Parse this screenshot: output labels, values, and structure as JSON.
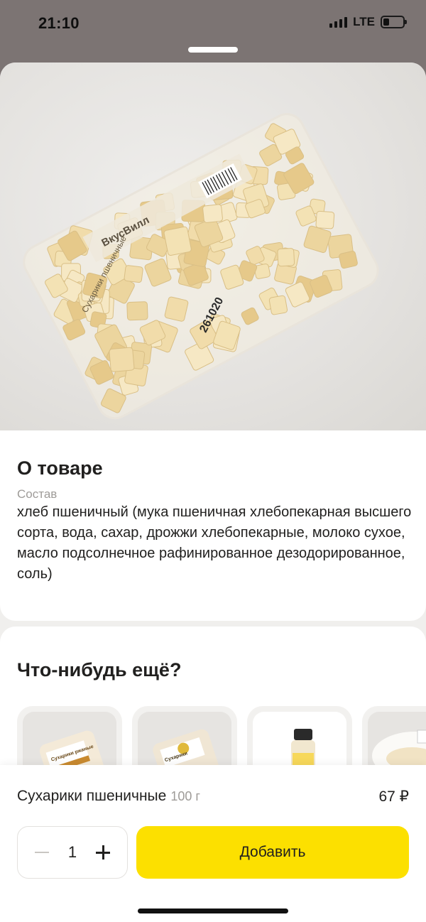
{
  "status_bar": {
    "time": "21:10",
    "network": "LTE",
    "icons": [
      "signal-icon",
      "battery-icon"
    ]
  },
  "product": {
    "image_brand_text": "ВкусВилл",
    "image_package_text": "Сухарики пшеничные",
    "image_code_text": "261020"
  },
  "about": {
    "title": "О товаре",
    "composition_label": "Состав",
    "composition_text": "хлеб пшеничный (мука пшеничная хлебопекарная высшего сорта, вода, сахар, дрожжи хлебопекарные, молоко сухое, масло подсолнечное рафинированное дезодорированное, соль)"
  },
  "more": {
    "title": "Что-нибудь ещё?",
    "items": [
      {
        "label": "Сухарики ржаные"
      },
      {
        "label": "Сухарики"
      },
      {
        "label": ""
      },
      {
        "label": ""
      }
    ]
  },
  "cart": {
    "name": "Сухарики пшеничные",
    "weight": "100 г",
    "price": "67 ₽",
    "quantity": "1",
    "add_label": "Добавить"
  },
  "colors": {
    "accent": "#fce000",
    "backdrop": "#7c7473",
    "text": "#21201f",
    "muted": "#9e9b98"
  }
}
